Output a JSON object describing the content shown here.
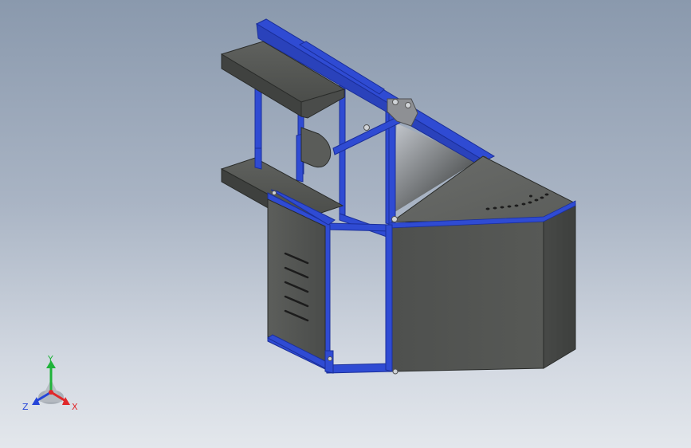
{
  "triad": {
    "x_label": "X",
    "y_label": "Y",
    "z_label": "Z",
    "colors": {
      "x": "#e0282b",
      "y": "#1fb33a",
      "z": "#2545d8"
    }
  },
  "model": {
    "colors": {
      "frame": "#2f4bd3",
      "frame_dark": "#1b2f9a",
      "panel": "#505250",
      "panel_light": "#6e706d",
      "panel_dark": "#3a3c3a",
      "hole": "#1c1c1c",
      "bolt": "#c9ccd0"
    }
  }
}
